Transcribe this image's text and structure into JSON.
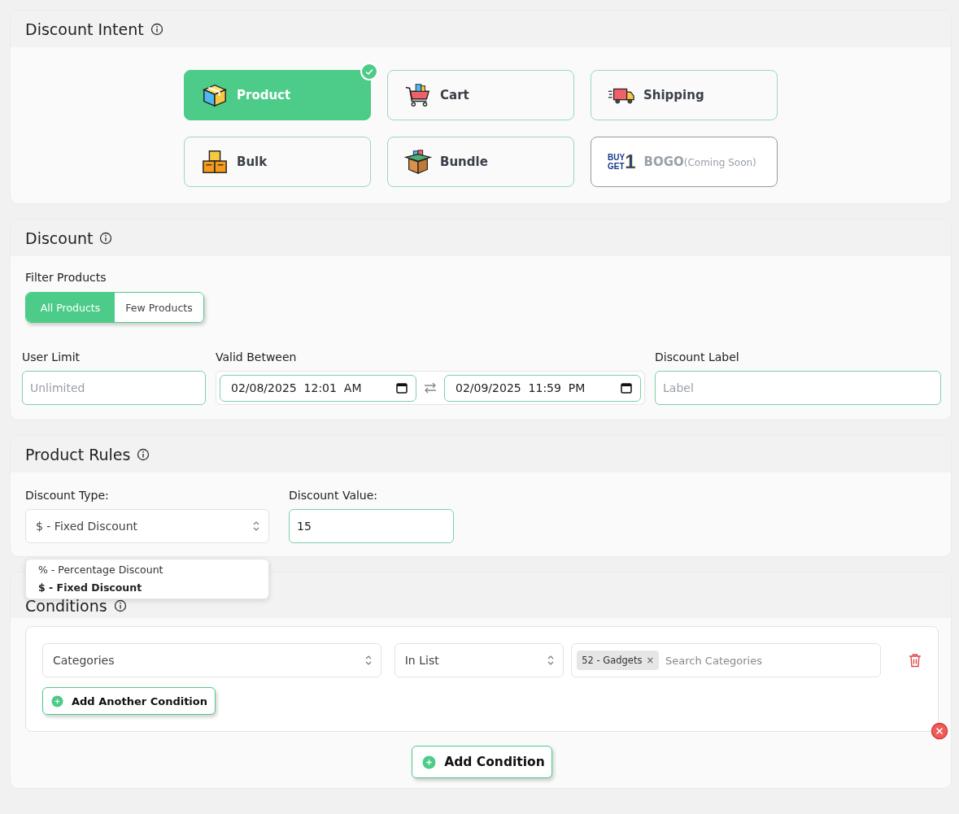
{
  "intent": {
    "title": "Discount Intent",
    "options": [
      {
        "label": "Product",
        "kind": "box",
        "selected": true,
        "disabled": false
      },
      {
        "label": "Cart",
        "kind": "cart",
        "selected": false,
        "disabled": false
      },
      {
        "label": "Shipping",
        "kind": "truck",
        "selected": false,
        "disabled": false
      },
      {
        "label": "Bulk",
        "kind": "crates",
        "selected": false,
        "disabled": false
      },
      {
        "label": "Bundle",
        "kind": "openbox",
        "selected": false,
        "disabled": false
      },
      {
        "label": "BOGO",
        "note": "(Coming Soon)",
        "kind": "bogo",
        "logo_lines": [
          "BUY",
          "GET"
        ],
        "logo_digit": "1",
        "selected": false,
        "disabled": true
      }
    ]
  },
  "discount": {
    "title": "Discount",
    "filter_label": "Filter Products",
    "filter_options": [
      {
        "label": "All Products",
        "selected": true
      },
      {
        "label": "Few Products",
        "selected": false
      }
    ],
    "user_limit": {
      "label": "User Limit",
      "placeholder": "Unlimited"
    },
    "valid_between": {
      "label": "Valid Between",
      "start": "02/08/2025  12:01  AM",
      "end": "02/09/2025  11:59  PM"
    },
    "discount_label": {
      "label": "Discount Label",
      "placeholder": "Label"
    }
  },
  "product_rules": {
    "title": "Product Rules",
    "type_label": "Discount Type:",
    "type_value": "$ - Fixed Discount",
    "value_label": "Discount Value:",
    "value": "15",
    "type_options": [
      {
        "label": "% - Percentage Discount",
        "selected": false
      },
      {
        "label": "$ - Fixed Discount",
        "selected": true
      }
    ]
  },
  "conditions": {
    "title": "Conditions",
    "rows": [
      {
        "field": "Categories",
        "operator": "In List",
        "tags": [
          "52 - Gadgets"
        ],
        "tag_remove": "×",
        "search_placeholder": "Search Categories"
      }
    ],
    "add_another": "Add Another Condition",
    "add": "Add Condition"
  }
}
